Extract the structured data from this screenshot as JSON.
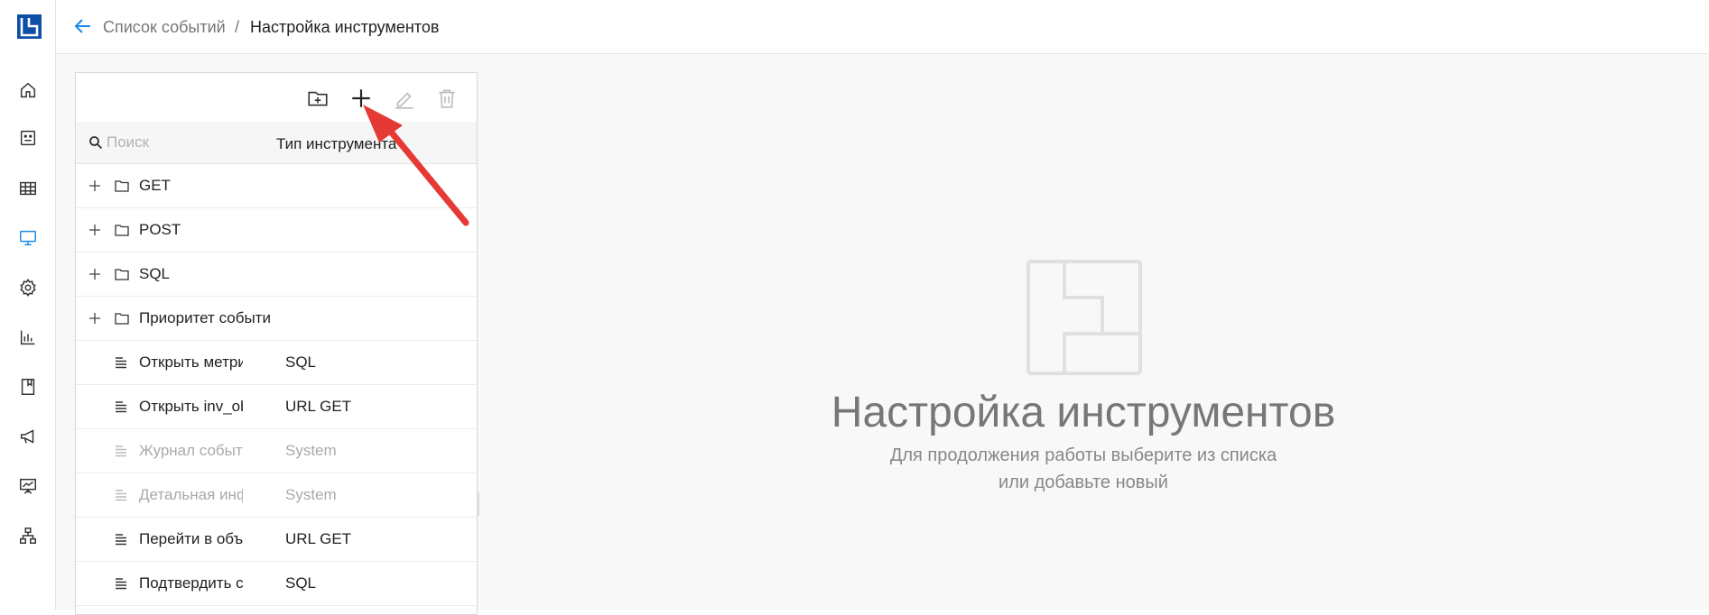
{
  "breadcrumb": {
    "parent": "Список событий",
    "separator": "/",
    "current": "Настройка инструментов"
  },
  "sidebar": {
    "items": [
      {
        "icon": "home-icon"
      },
      {
        "icon": "badge-icon"
      },
      {
        "icon": "table-icon"
      },
      {
        "icon": "monitor-icon",
        "active": true
      },
      {
        "icon": "gear-icon"
      },
      {
        "icon": "bar-chart-icon"
      },
      {
        "icon": "book-icon"
      },
      {
        "icon": "megaphone-icon"
      },
      {
        "icon": "presentation-chart-icon"
      },
      {
        "icon": "hierarchy-icon"
      }
    ]
  },
  "toolbar": {
    "buttons": [
      {
        "icon": "add-folder-icon",
        "enabled": true
      },
      {
        "icon": "plus-icon",
        "enabled": true
      },
      {
        "icon": "pencil-icon",
        "enabled": false
      },
      {
        "icon": "trash-icon",
        "enabled": false
      }
    ]
  },
  "filter": {
    "search_placeholder": "Поиск",
    "type_column": "Тип инструмента"
  },
  "rows": [
    {
      "kind": "folder",
      "name": "GET",
      "type": ""
    },
    {
      "kind": "folder",
      "name": "POST",
      "type": ""
    },
    {
      "kind": "folder",
      "name": "SQL",
      "type": ""
    },
    {
      "kind": "folder",
      "name": "Приоритет событи",
      "type": ""
    },
    {
      "kind": "item",
      "name": "Открыть метрику",
      "type": "SQL",
      "disabled": false
    },
    {
      "kind": "item",
      "name": "Открыть inv_obj_id",
      "type": "URL GET",
      "disabled": false
    },
    {
      "kind": "item",
      "name": "Журнал события",
      "type": "System",
      "disabled": true
    },
    {
      "kind": "item",
      "name": "Детальная информ",
      "type": "System",
      "disabled": true
    },
    {
      "kind": "item",
      "name": "Перейти в объект",
      "type": "URL GET",
      "disabled": false
    },
    {
      "kind": "item",
      "name": "Подтвердить собы",
      "type": "SQL",
      "disabled": false
    }
  ],
  "empty_state": {
    "title": "Настройка инструментов",
    "line1": "Для продолжения работы выберите из списка",
    "line2": "или добавьте новый"
  },
  "colors": {
    "accent": "#1e88e5",
    "logo": "#0d4ea6",
    "annotation_arrow": "#e53935"
  }
}
